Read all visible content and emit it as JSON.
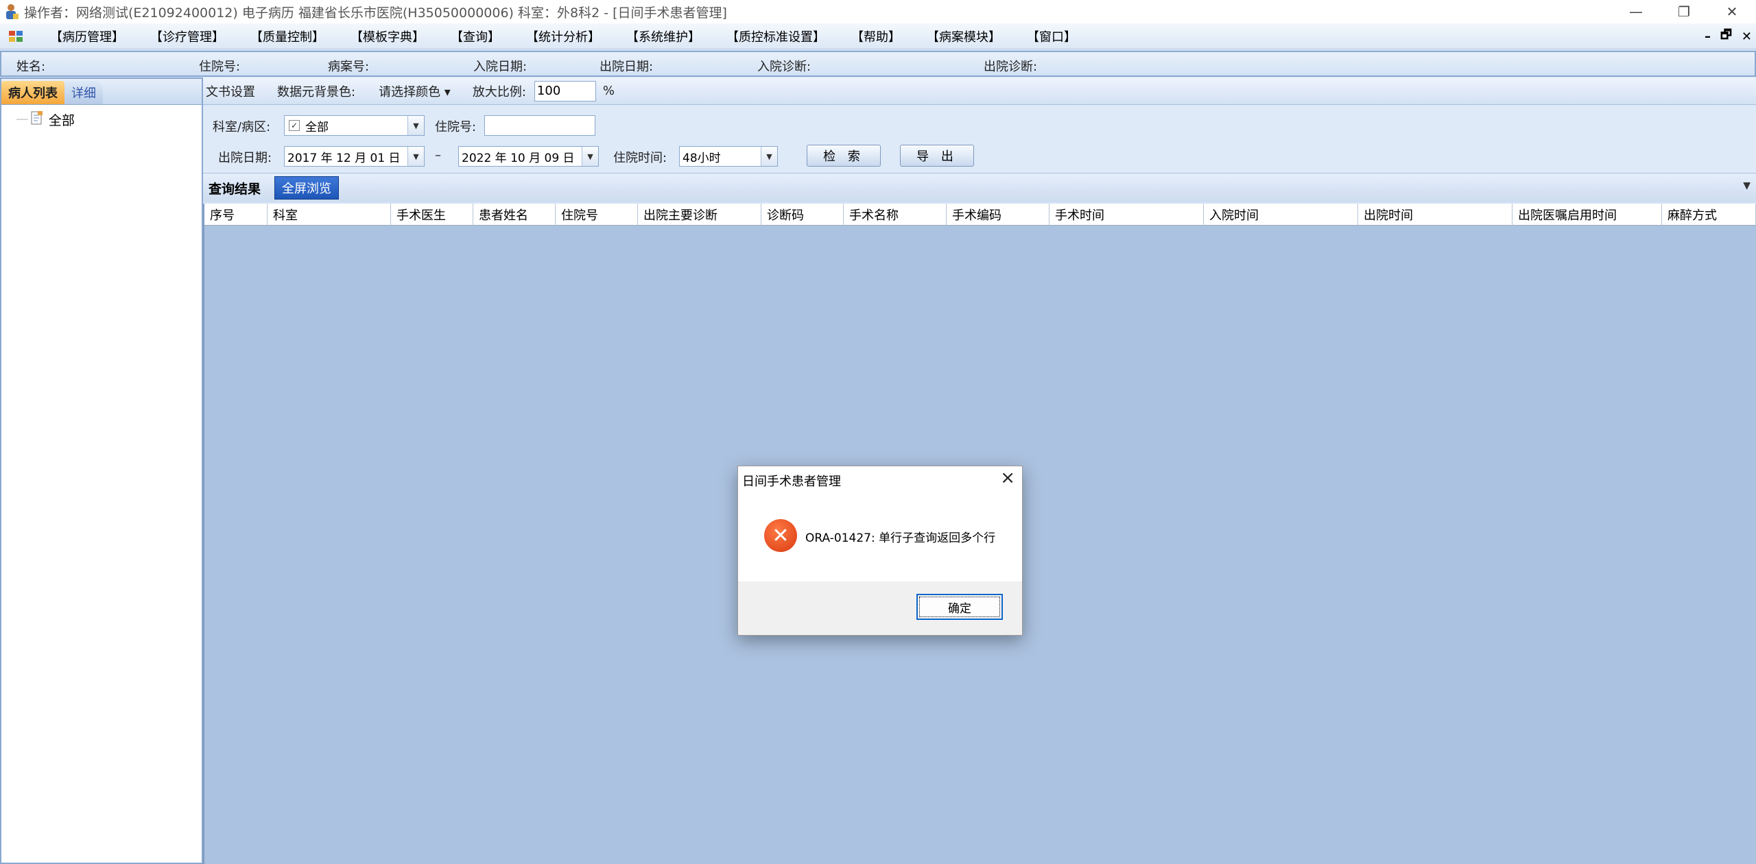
{
  "window": {
    "title": "操作者：网络测试(E21092400012) 电子病历  福建省长乐市医院(H35050000006)  科室：外8科2 - [日间手术患者管理]",
    "minimize": "—",
    "restore": "❐",
    "close": "✕"
  },
  "menu": {
    "items": [
      "【病历管理】",
      "【诊疗管理】",
      "【质量控制】",
      "【模板字典】",
      "【查询】",
      "【统计分析】",
      "【系统维护】",
      "【质控标准设置】",
      "【帮助】",
      "【病案模块】",
      "【窗口】"
    ],
    "mdi_min": "–",
    "mdi_restore": "🗗",
    "mdi_close": "✕"
  },
  "infostrip": {
    "name": "姓名:",
    "inpatient_no": "住院号:",
    "record_no": "病案号:",
    "admit_date": "入院日期:",
    "discharge_date": "出院日期:",
    "admit_diag": "入院诊断:",
    "discharge_diag": "出院诊断:"
  },
  "left": {
    "tab_patients": "病人列表",
    "tab_detail": "详细",
    "tree_root": "全部"
  },
  "toolstrip": {
    "doc_settings": "文书设置",
    "bg_color": "数据元背景色:",
    "choose_color": "请选择颜色 ▾",
    "zoom_label": "放大比例:",
    "zoom_value": "100",
    "zoom_unit": "%"
  },
  "filters": {
    "dept_label": "科室/病区:",
    "dept_value": "全部",
    "inpatient_label": "住院号:",
    "discharge_label": "出院日期:",
    "date_from": "2017 年 12 月 01 日",
    "date_sep": "–",
    "date_to": "2022 年 10 月 09 日",
    "stay_label": "住院时间:",
    "stay_value": "48小时",
    "search_btn": "检 索",
    "export_btn": "导 出"
  },
  "results": {
    "tab_results": "查询结果",
    "tab_fullscreen": "全屏浏览",
    "columns": [
      "序号",
      "科室",
      "手术医生",
      "患者姓名",
      "住院号",
      "出院主要诊断",
      "诊断码",
      "手术名称",
      "手术编码",
      "手术时间",
      "入院时间",
      "出院时间",
      "出院医嘱启用时间",
      "麻醉方式"
    ]
  },
  "dialog": {
    "title": "日间手术患者管理",
    "message": "ORA-01427: 单行子查询返回多个行",
    "ok": "确定"
  },
  "colors": {
    "grid_bg": "#abc2e0",
    "error_icon": "#e0481a",
    "ok_border": "#0a64c8"
  }
}
